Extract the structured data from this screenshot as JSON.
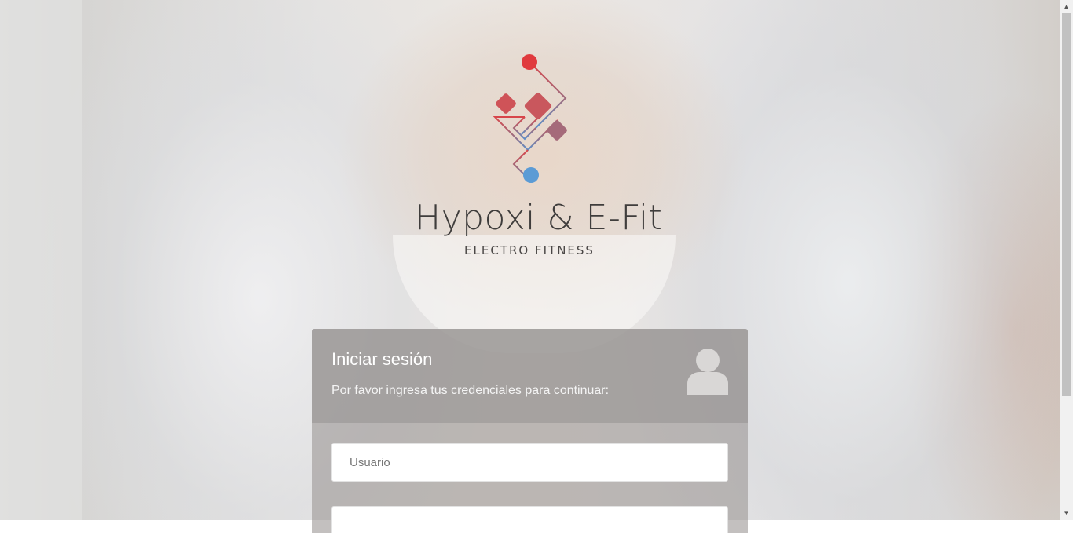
{
  "brand": {
    "name": "Hypoxi & E-Fit",
    "tagline": "ELECTRO FITNESS"
  },
  "login": {
    "title": "Iniciar sesión",
    "subtitle": "Por favor ingresa tus credenciales para continuar:",
    "username_placeholder": "Usuario",
    "password_placeholder": ""
  },
  "icons": {
    "user": "user-avatar-icon",
    "logo": "circuit-diamond-logo"
  },
  "colors": {
    "logo_red": "#e03a3e",
    "logo_blue": "#5b9bd5",
    "panel_header": "#969391"
  }
}
